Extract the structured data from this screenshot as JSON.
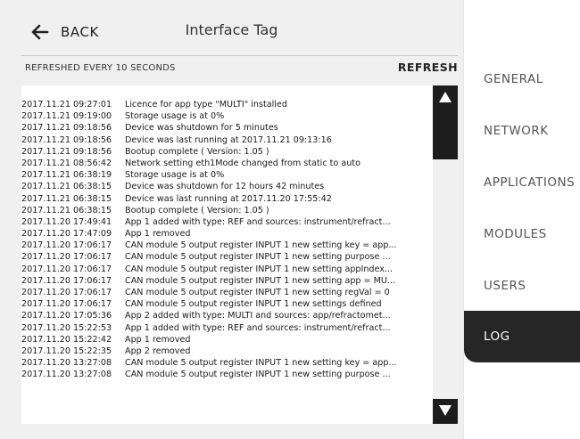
{
  "header": {
    "back_label": "BACK",
    "title": "Interface Tag"
  },
  "subbar": {
    "refresh_note": "REFRESHED EVERY 10 SECONDS",
    "refresh_label": "REFRESH"
  },
  "log": {
    "entries": [
      {
        "time": "2017.11.21 09:27:01",
        "message": "Licence for app type \"MULTI\" installed"
      },
      {
        "time": "2017.11.21 09:19:00",
        "message": "Storage usage is at 0%"
      },
      {
        "time": "2017.11.21 09:18:56",
        "message": "Device was shutdown for 5 minutes"
      },
      {
        "time": "2017.11.21 09:18:56",
        "message": "Device was last running at 2017.11.21 09:13:16"
      },
      {
        "time": "2017.11.21 09:18:56",
        "message": "Bootup complete ( Version: 1.05 )"
      },
      {
        "time": "2017.11.21 08:56:42",
        "message": "Network setting eth1Mode changed from static to auto"
      },
      {
        "time": "2017.11.21 06:38:19",
        "message": "Storage usage is at 0%"
      },
      {
        "time": "2017.11.21 06:38:15",
        "message": "Device was shutdown for 12 hours 42 minutes"
      },
      {
        "time": "2017.11.21 06:38:15",
        "message": "Device was last running at 2017.11.20 17:55:42"
      },
      {
        "time": "2017.11.21 06:38:15",
        "message": "Bootup complete ( Version: 1.05 )"
      },
      {
        "time": "2017.11.20 17:49:41",
        "message": "App 1 added with type: REF and sources: instrument/refract..."
      },
      {
        "time": "2017.11.20 17:47:09",
        "message": "App 1 removed"
      },
      {
        "time": "2017.11.20 17:06:17",
        "message": "CAN module 5 output register INPUT 1 new setting key = app..."
      },
      {
        "time": "2017.11.20 17:06:17",
        "message": "CAN module 5 output register INPUT 1 new setting purpose ..."
      },
      {
        "time": "2017.11.20 17:06:17",
        "message": "CAN module 5 output register INPUT 1 new setting appIndex..."
      },
      {
        "time": "2017.11.20 17:06:17",
        "message": "CAN module 5 output register INPUT 1 new setting app = MU..."
      },
      {
        "time": "2017.11.20 17:06:17",
        "message": "CAN module 5 output register INPUT 1 new setting regVal = 0"
      },
      {
        "time": "2017.11.20 17:06:17",
        "message": "CAN module 5 output register INPUT 1 new settings defined"
      },
      {
        "time": "2017.11.20 17:05:36",
        "message": "App 2 added with type: MULTI and sources: app/refractomet..."
      },
      {
        "time": "2017.11.20 15:22:53",
        "message": "App 1 added with type: REF and sources: instrument/refract..."
      },
      {
        "time": "2017.11.20 15:22:42",
        "message": "App 1 removed"
      },
      {
        "time": "2017.11.20 15:22:35",
        "message": "App 2 removed"
      },
      {
        "time": "2017.11.20 13:27:08",
        "message": "CAN module 5 output register INPUT 1 new setting key = app..."
      },
      {
        "time": "2017.11.20 13:27:08",
        "message": "CAN module 5 output register INPUT 1 new setting purpose ..."
      }
    ]
  },
  "nav": {
    "items": [
      {
        "label": "GENERAL",
        "active": false
      },
      {
        "label": "NETWORK",
        "active": false
      },
      {
        "label": "APPLICATIONS",
        "active": false
      },
      {
        "label": "MODULES",
        "active": false
      },
      {
        "label": "USERS",
        "active": false
      },
      {
        "label": "LOG",
        "active": true
      }
    ]
  },
  "icons": {
    "back": "arrow-left-icon",
    "scroll_up": "triangle-up-icon",
    "scroll_down": "triangle-down-icon"
  },
  "colors": {
    "panel_bg": "#f0f0f0",
    "accent_dark": "#262626",
    "scroll_dark": "#1d1d1d"
  }
}
